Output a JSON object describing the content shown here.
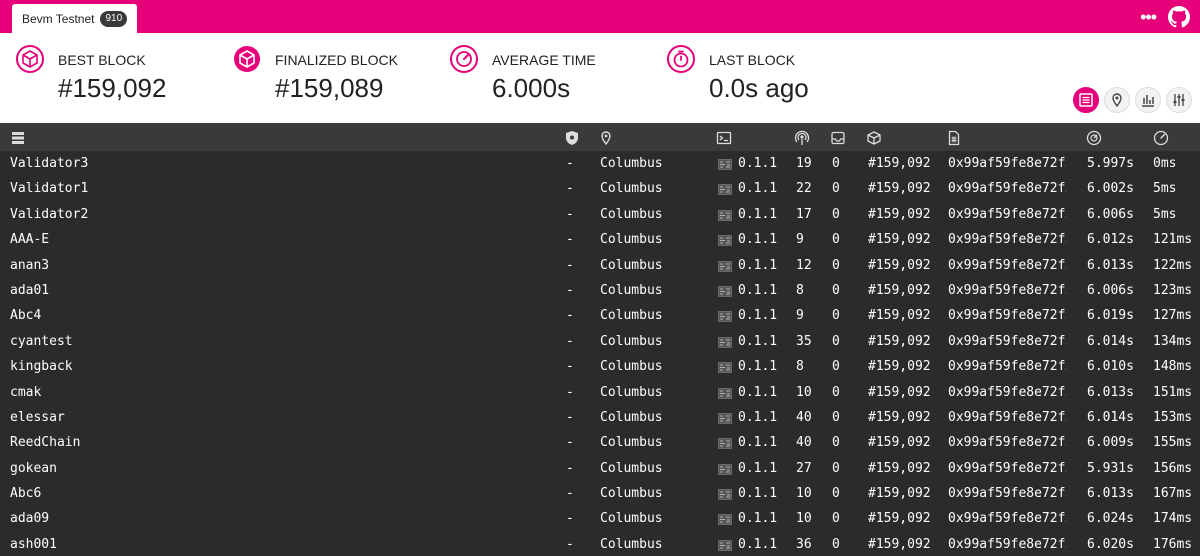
{
  "header": {
    "chain_name": "Bevm Testnet",
    "node_count": "910",
    "brand_color": "#e6007a"
  },
  "stats": [
    {
      "label": "BEST BLOCK",
      "value": "#159,092",
      "icon": "cube-icon"
    },
    {
      "label": "FINALIZED BLOCK",
      "value": "#159,089",
      "icon": "cube-check-icon"
    },
    {
      "label": "AVERAGE TIME",
      "value": "6.000s",
      "icon": "timer-icon"
    },
    {
      "label": "LAST BLOCK",
      "value": "0.0s ago",
      "icon": "stopwatch-icon"
    }
  ],
  "view_buttons": [
    "list-view-icon",
    "map-view-icon",
    "stats-view-icon",
    "settings-view-icon"
  ],
  "table": {
    "columns": [
      "node-name",
      "validator",
      "location",
      "implementation",
      "peers",
      "transactions",
      "block-number",
      "block-hash",
      "block-time",
      "propagation-time"
    ],
    "rows": [
      {
        "name": "Validator3",
        "validator": "-",
        "location": "Columbus",
        "version": "0.1.1",
        "peers": "19",
        "txs": "0",
        "block": "#159,092",
        "hash": "0x99af59fe8e72f…",
        "time": "5.997s",
        "prop": "0ms"
      },
      {
        "name": "Validator1",
        "validator": "-",
        "location": "Columbus",
        "version": "0.1.1",
        "peers": "22",
        "txs": "0",
        "block": "#159,092",
        "hash": "0x99af59fe8e72f…",
        "time": "6.002s",
        "prop": "5ms"
      },
      {
        "name": "Validator2",
        "validator": "-",
        "location": "Columbus",
        "version": "0.1.1",
        "peers": "17",
        "txs": "0",
        "block": "#159,092",
        "hash": "0x99af59fe8e72f…",
        "time": "6.006s",
        "prop": "5ms"
      },
      {
        "name": "AAA-E",
        "validator": "-",
        "location": "Columbus",
        "version": "0.1.1",
        "peers": "9",
        "txs": "0",
        "block": "#159,092",
        "hash": "0x99af59fe8e72f…",
        "time": "6.012s",
        "prop": "121ms"
      },
      {
        "name": "anan3",
        "validator": "-",
        "location": "Columbus",
        "version": "0.1.1",
        "peers": "12",
        "txs": "0",
        "block": "#159,092",
        "hash": "0x99af59fe8e72f…",
        "time": "6.013s",
        "prop": "122ms"
      },
      {
        "name": "ada01",
        "validator": "-",
        "location": "Columbus",
        "version": "0.1.1",
        "peers": "8",
        "txs": "0",
        "block": "#159,092",
        "hash": "0x99af59fe8e72f…",
        "time": "6.006s",
        "prop": "123ms"
      },
      {
        "name": "Abc4",
        "validator": "-",
        "location": "Columbus",
        "version": "0.1.1",
        "peers": "9",
        "txs": "0",
        "block": "#159,092",
        "hash": "0x99af59fe8e72f…",
        "time": "6.019s",
        "prop": "127ms"
      },
      {
        "name": "cyantest",
        "validator": "-",
        "location": "Columbus",
        "version": "0.1.1",
        "peers": "35",
        "txs": "0",
        "block": "#159,092",
        "hash": "0x99af59fe8e72f…",
        "time": "6.014s",
        "prop": "134ms"
      },
      {
        "name": "kingback",
        "validator": "-",
        "location": "Columbus",
        "version": "0.1.1",
        "peers": "8",
        "txs": "0",
        "block": "#159,092",
        "hash": "0x99af59fe8e72f…",
        "time": "6.010s",
        "prop": "148ms"
      },
      {
        "name": "cmak",
        "validator": "-",
        "location": "Columbus",
        "version": "0.1.1",
        "peers": "10",
        "txs": "0",
        "block": "#159,092",
        "hash": "0x99af59fe8e72f…",
        "time": "6.013s",
        "prop": "151ms"
      },
      {
        "name": "elessar",
        "validator": "-",
        "location": "Columbus",
        "version": "0.1.1",
        "peers": "40",
        "txs": "0",
        "block": "#159,092",
        "hash": "0x99af59fe8e72f…",
        "time": "6.014s",
        "prop": "153ms"
      },
      {
        "name": "ReedChain",
        "validator": "-",
        "location": "Columbus",
        "version": "0.1.1",
        "peers": "40",
        "txs": "0",
        "block": "#159,092",
        "hash": "0x99af59fe8e72f…",
        "time": "6.009s",
        "prop": "155ms"
      },
      {
        "name": "gokean",
        "validator": "-",
        "location": "Columbus",
        "version": "0.1.1",
        "peers": "27",
        "txs": "0",
        "block": "#159,092",
        "hash": "0x99af59fe8e72f…",
        "time": "5.931s",
        "prop": "156ms"
      },
      {
        "name": "Abc6",
        "validator": "-",
        "location": "Columbus",
        "version": "0.1.1",
        "peers": "10",
        "txs": "0",
        "block": "#159,092",
        "hash": "0x99af59fe8e72f…",
        "time": "6.013s",
        "prop": "167ms"
      },
      {
        "name": "ada09",
        "validator": "-",
        "location": "Columbus",
        "version": "0.1.1",
        "peers": "10",
        "txs": "0",
        "block": "#159,092",
        "hash": "0x99af59fe8e72f…",
        "time": "6.024s",
        "prop": "174ms"
      },
      {
        "name": "ash001",
        "validator": "-",
        "location": "Columbus",
        "version": "0.1.1",
        "peers": "36",
        "txs": "0",
        "block": "#159,092",
        "hash": "0x99af59fe8e72f…",
        "time": "6.020s",
        "prop": "176ms"
      }
    ]
  }
}
